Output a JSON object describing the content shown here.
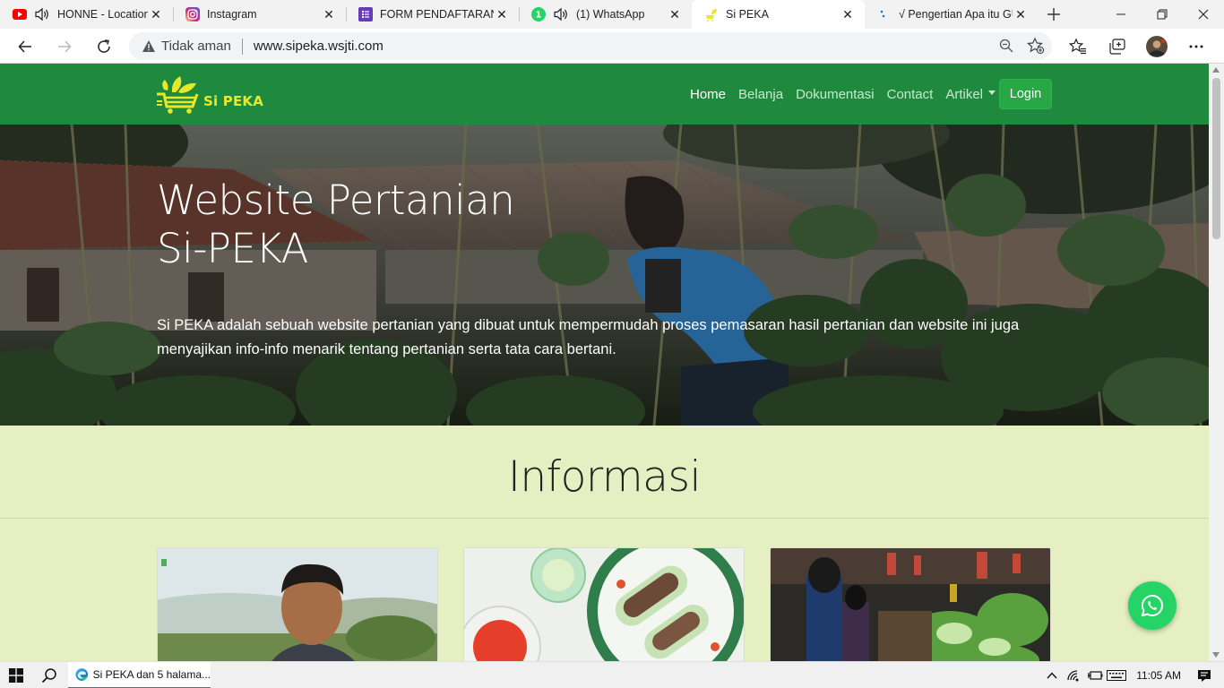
{
  "browser": {
    "tabs": [
      {
        "title": "HONNE - Location",
        "favicon": "youtube-icon",
        "audio": true,
        "active": false
      },
      {
        "title": "Instagram",
        "favicon": "instagram-icon",
        "audio": false,
        "active": false
      },
      {
        "title": "FORM PENDAFTARAN |",
        "favicon": "forms-icon",
        "audio": false,
        "active": false
      },
      {
        "title": "(1) WhatsApp",
        "favicon": "whatsapp-icon",
        "audio": true,
        "badge": "1",
        "active": false
      },
      {
        "title": "Si PEKA",
        "favicon": "sipeka-icon",
        "audio": false,
        "active": true
      },
      {
        "title": "√ Pengertian Apa itu GU",
        "favicon": "site-icon",
        "audio": false,
        "active": false
      }
    ],
    "security_label": "Tidak aman",
    "url": "www.sipeka.wsjti.com"
  },
  "site": {
    "brand": "Si PEKA",
    "nav": {
      "home": "Home",
      "shop": "Belanja",
      "docs": "Dokumentasi",
      "contact": "Contact",
      "articles": "Artikel",
      "login": "Login"
    },
    "hero": {
      "title_line1": "Website Pertanian",
      "title_line2": "Si-PEKA",
      "description": "Si PEKA adalah sebuah website pertanian yang dibuat untuk mempermudah proses pemasaran hasil pertanian dan website ini juga menyajikan info-info menarik tentang pertanian serta tata cara bertani."
    },
    "section_title": "Informasi"
  },
  "taskbar": {
    "app_label": "Si PEKA dan 5 halama...",
    "time": "11:05 AM"
  },
  "colors": {
    "nav_green": "#1f8a3e",
    "login_green": "#28a745",
    "page_bg": "#e5efc1",
    "brand_yellow": "#e8e82b",
    "whatsapp": "#25d366"
  }
}
